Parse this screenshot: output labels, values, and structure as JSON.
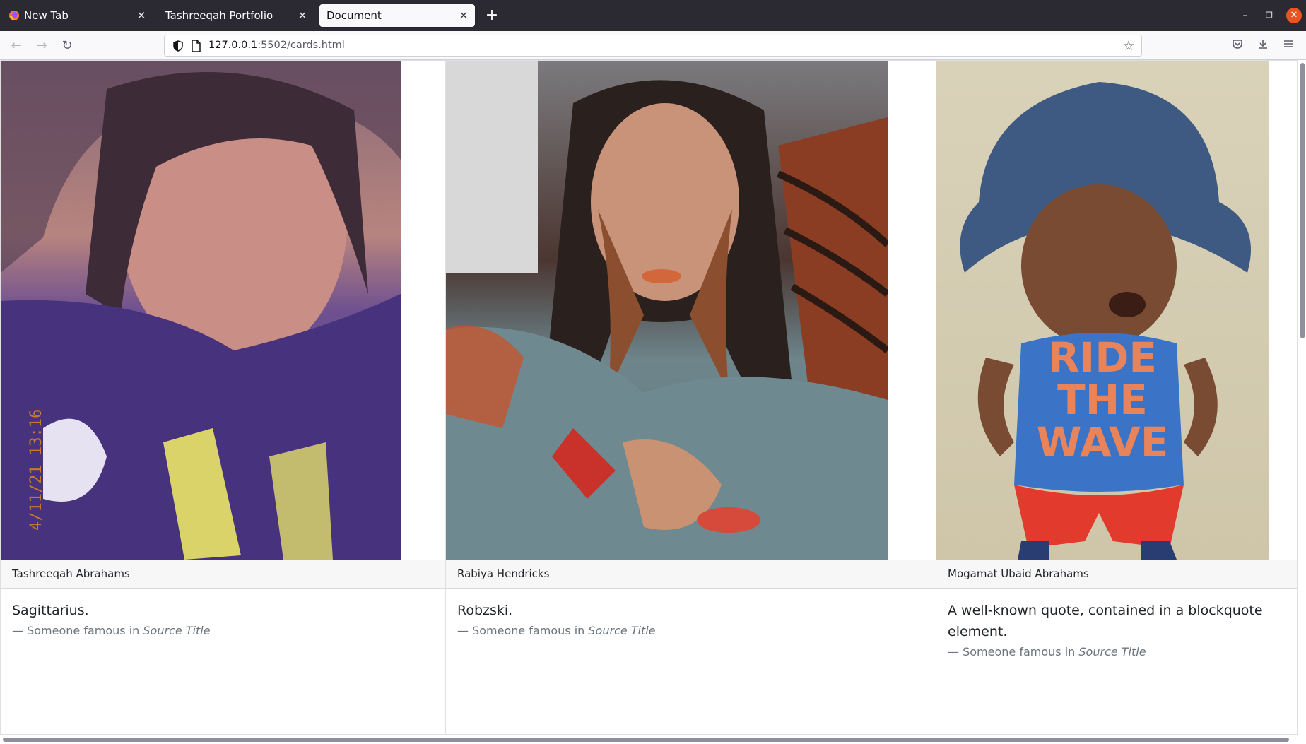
{
  "tabs": [
    {
      "title": "New Tab",
      "active": false
    },
    {
      "title": "Tashreeqah Portfolio",
      "active": false
    },
    {
      "title": "Document",
      "active": true
    }
  ],
  "navbar": {
    "url_host": "127.0.0.1",
    "url_rest": ":5502/cards.html"
  },
  "cards": [
    {
      "image_alt": "Portrait photo of girl in purple shirt",
      "photo_timestamp": "4/11/21 13:16",
      "header": "Tashreeqah Abrahams",
      "quote": "Sagittarius.",
      "footer_prefix": "— Someone famous in ",
      "footer_cite": "Source Title"
    },
    {
      "image_alt": "Selfie of woman with long hair",
      "header": "Rabiya Hendricks",
      "quote": "Robzski.",
      "footer_prefix": "— Someone famous in ",
      "footer_cite": "Source Title"
    },
    {
      "image_alt": "Toddler in blue hat and tank top",
      "shirt_text": "RIDE THE WAVE",
      "header": "Mogamat Ubaid Abrahams",
      "quote": "A well-known quote, contained in a blockquote element.",
      "footer_prefix": "— Someone famous in ",
      "footer_cite": "Source Title"
    }
  ],
  "colors": {
    "tabbar_bg": "#2b2a33",
    "navbar_bg": "#f9f9fb",
    "card_header_bg": "#f7f7f7",
    "footer_text": "#6c757d",
    "window_close": "#e95420"
  },
  "icons": {
    "back": "arrow-left-icon",
    "forward": "arrow-right-icon",
    "reload": "reload-icon",
    "bookmark": "star-icon",
    "pocket": "pocket-icon",
    "downloads": "download-icon",
    "menu": "hamburger-menu-icon"
  }
}
